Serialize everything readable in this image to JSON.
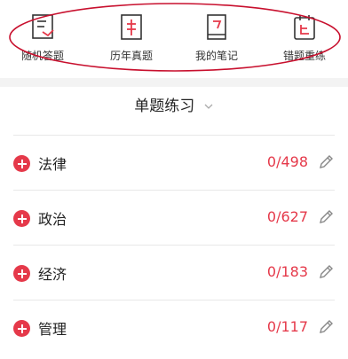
{
  "topnav": {
    "items": [
      {
        "label": "随机答题",
        "icon": "dice-list-icon"
      },
      {
        "label": "历年真题",
        "icon": "exam-paper-icon"
      },
      {
        "label": "我的笔记",
        "icon": "notebook-icon"
      },
      {
        "label": "错题重练",
        "icon": "calendar-redo-icon"
      }
    ]
  },
  "practice": {
    "title": "单题练习",
    "subjects": [
      {
        "name": "法律",
        "progress": "0/498"
      },
      {
        "name": "政治",
        "progress": "0/627"
      },
      {
        "name": "经济",
        "progress": "0/183"
      },
      {
        "name": "管理",
        "progress": "0/117"
      }
    ]
  },
  "colors": {
    "accent": "#e5394a",
    "annotation": "#c8102e",
    "divider": "#e8e8e8",
    "gap": "#f3f3f3"
  }
}
